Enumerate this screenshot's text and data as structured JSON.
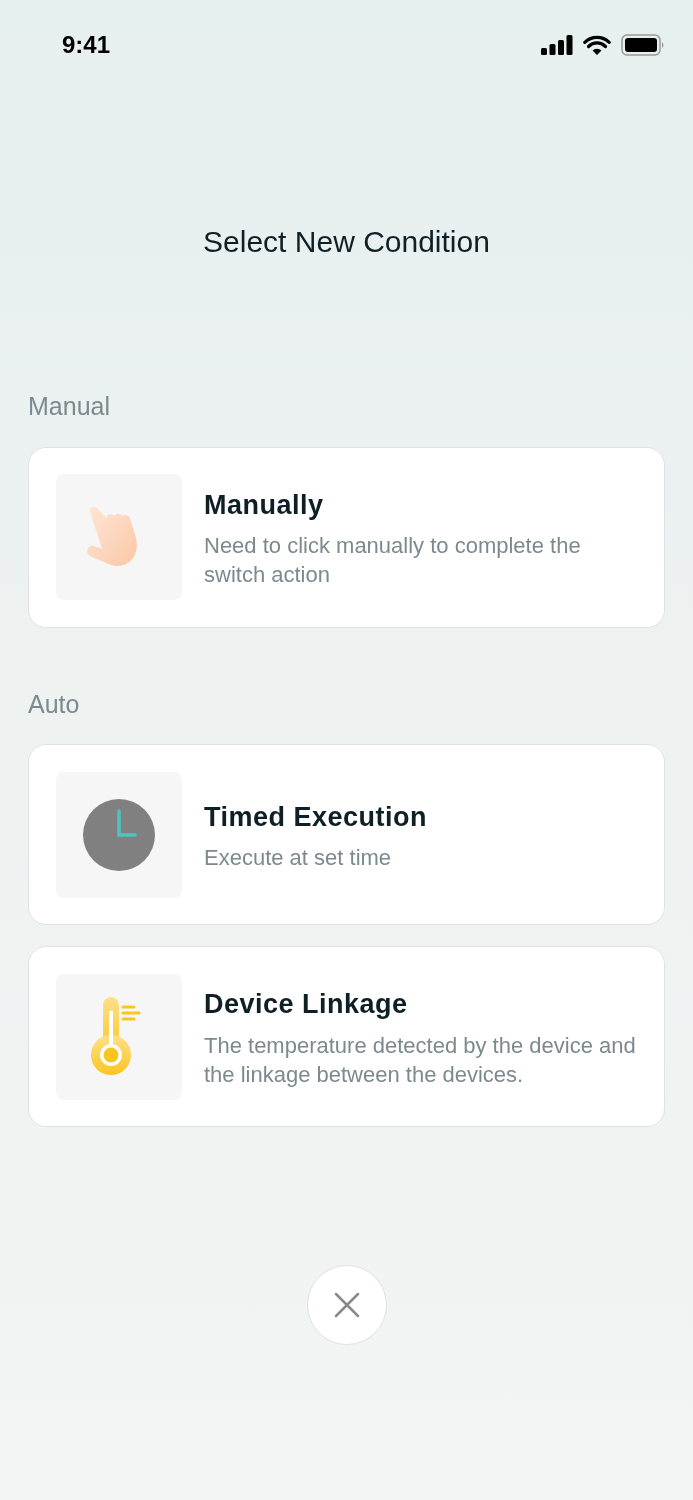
{
  "status_bar": {
    "time": "9:41"
  },
  "title": "Select New Condition",
  "sections": [
    {
      "label": "Manual",
      "items": [
        {
          "kind": "hand",
          "title": "Manually",
          "description": "Need to click manually to complete the switch action"
        }
      ]
    },
    {
      "label": "Auto",
      "items": [
        {
          "kind": "clock",
          "title": "Timed Execution",
          "description": "Execute at set time"
        },
        {
          "kind": "thermometer",
          "title": "Device Linkage",
          "description": "The temperature detected by the device and the linkage between the devices."
        }
      ]
    }
  ]
}
